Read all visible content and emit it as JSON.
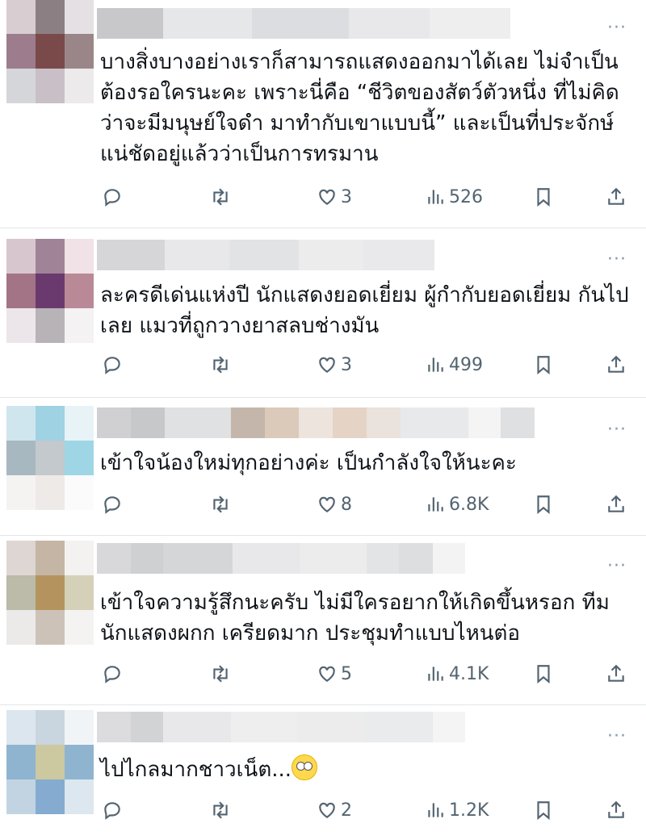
{
  "replies": [
    {
      "text": "บางสิ่งบางอย่างเราก็สามารถแสดงออกมาได้เลย ไม่จำเป็นต้องรอใครนะคะ เพราะนี่คือ “ชีวิตของสัตว์ตัวหนึ่ง ที่ไม่คิดว่าจะมีมนุษย์ใจดำ มาทำกับเขาแบบนี้” และเป็นที่ประจักษ์แน่ชัดอยู่แล้วว่าเป็นการทรมาน",
      "likes": "3",
      "views": "526"
    },
    {
      "text": "ละครดีเด่นแห่งปี นักแสดงยอดเยี่ยม ผู้กำกับยอดเยี่ยม กันไปเลย แมวที่ถูกวางยาสลบช่างมัน",
      "likes": "3",
      "views": "499"
    },
    {
      "text": "เข้าใจน้องใหม่ทุกอย่างค่ะ เป็นกำลังใจให้นะคะ",
      "likes": "8",
      "views": "6.8K"
    },
    {
      "text": "เข้าใจความรู้สึกนะครับ ไม่มีใครอยากให้เกิดขึ้นหรอก ทีมนักแสดงผกก เครียดมาก ประชุมทำแบบไหนต่อ",
      "likes": "5",
      "views": "4.1K"
    },
    {
      "text": "ไปไกลมากชาวเน็ต...",
      "likes": "2",
      "views": "1.2K"
    }
  ],
  "more_label": "···",
  "emoji": "rolling-eyes",
  "colors": {
    "text": "#0f1419",
    "muted": "#536471",
    "divider": "#e1e6ea"
  }
}
